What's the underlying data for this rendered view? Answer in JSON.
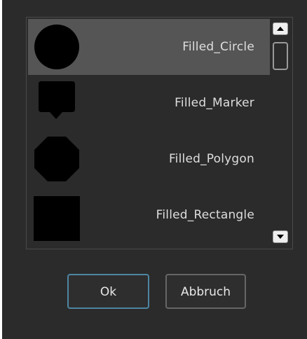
{
  "dialog": {
    "list": {
      "items": [
        {
          "label": "Filled_Circle",
          "icon": "filled-circle-icon",
          "selected": true
        },
        {
          "label": "Filled_Marker",
          "icon": "filled-marker-icon",
          "selected": false
        },
        {
          "label": "Filled_Polygon",
          "icon": "filled-polygon-icon",
          "selected": false
        },
        {
          "label": "Filled_Rectangle",
          "icon": "filled-rectangle-icon",
          "selected": false
        }
      ]
    },
    "buttons": {
      "ok_label": "Ok",
      "cancel_label": "Abbruch"
    },
    "colors": {
      "background": "#2b2b2b",
      "selection": "#555555",
      "text": "#dedede",
      "focus_border": "#4e86a2",
      "shape_fill": "#000000"
    }
  }
}
